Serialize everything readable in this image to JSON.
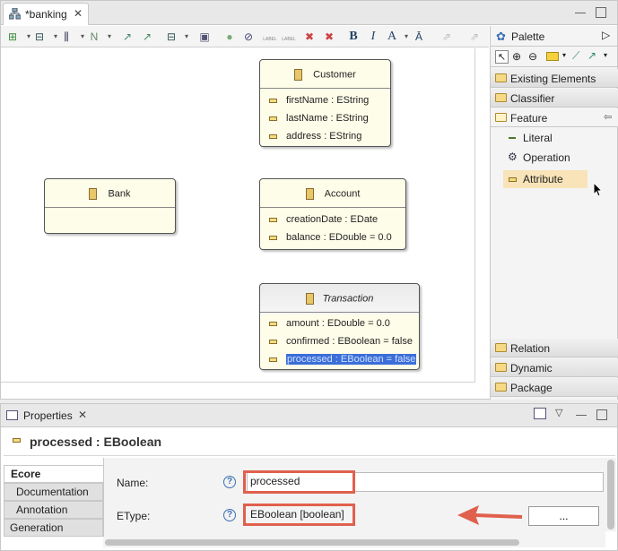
{
  "editor": {
    "tab_label": "*banking",
    "toolbar": {
      "bold": "B",
      "italic": "I",
      "font_color": "A",
      "label_a": "LABEL",
      "label_b": "LABEL"
    },
    "classes": [
      {
        "name": "Customer",
        "attributes": [
          "firstName : EString",
          "lastName : EString",
          "address : EString"
        ]
      },
      {
        "name": "Bank",
        "attributes": []
      },
      {
        "name": "Account",
        "attributes": [
          "creationDate : EDate",
          "balance : EDouble = 0.0"
        ]
      },
      {
        "name": "Transaction",
        "attributes": [
          "amount : EDouble = 0.0",
          "confirmed : EBoolean = false",
          "processed : EBoolean = false"
        ]
      }
    ]
  },
  "palette": {
    "title": "Palette",
    "drawers": [
      "Existing Elements",
      "Classifier",
      "Feature",
      "Relation",
      "Dynamic",
      "Package"
    ],
    "feature_items": [
      "Literal",
      "Operation",
      "Attribute"
    ]
  },
  "properties": {
    "view_title": "Properties",
    "element_title": "processed : EBoolean",
    "tabs": [
      "Ecore",
      "Documentation",
      "Annotation",
      "Generation"
    ],
    "name_label": "Name:",
    "name_value": "processed",
    "etype_label": "EType:",
    "etype_value": "EBoolean [boolean]",
    "browse_button": "...",
    "help": "?"
  },
  "colors": {
    "highlight_box": "#e0604d",
    "arrow": "#e0604d",
    "class_fill": "#fefde9",
    "selection": "#3b6ed8"
  }
}
